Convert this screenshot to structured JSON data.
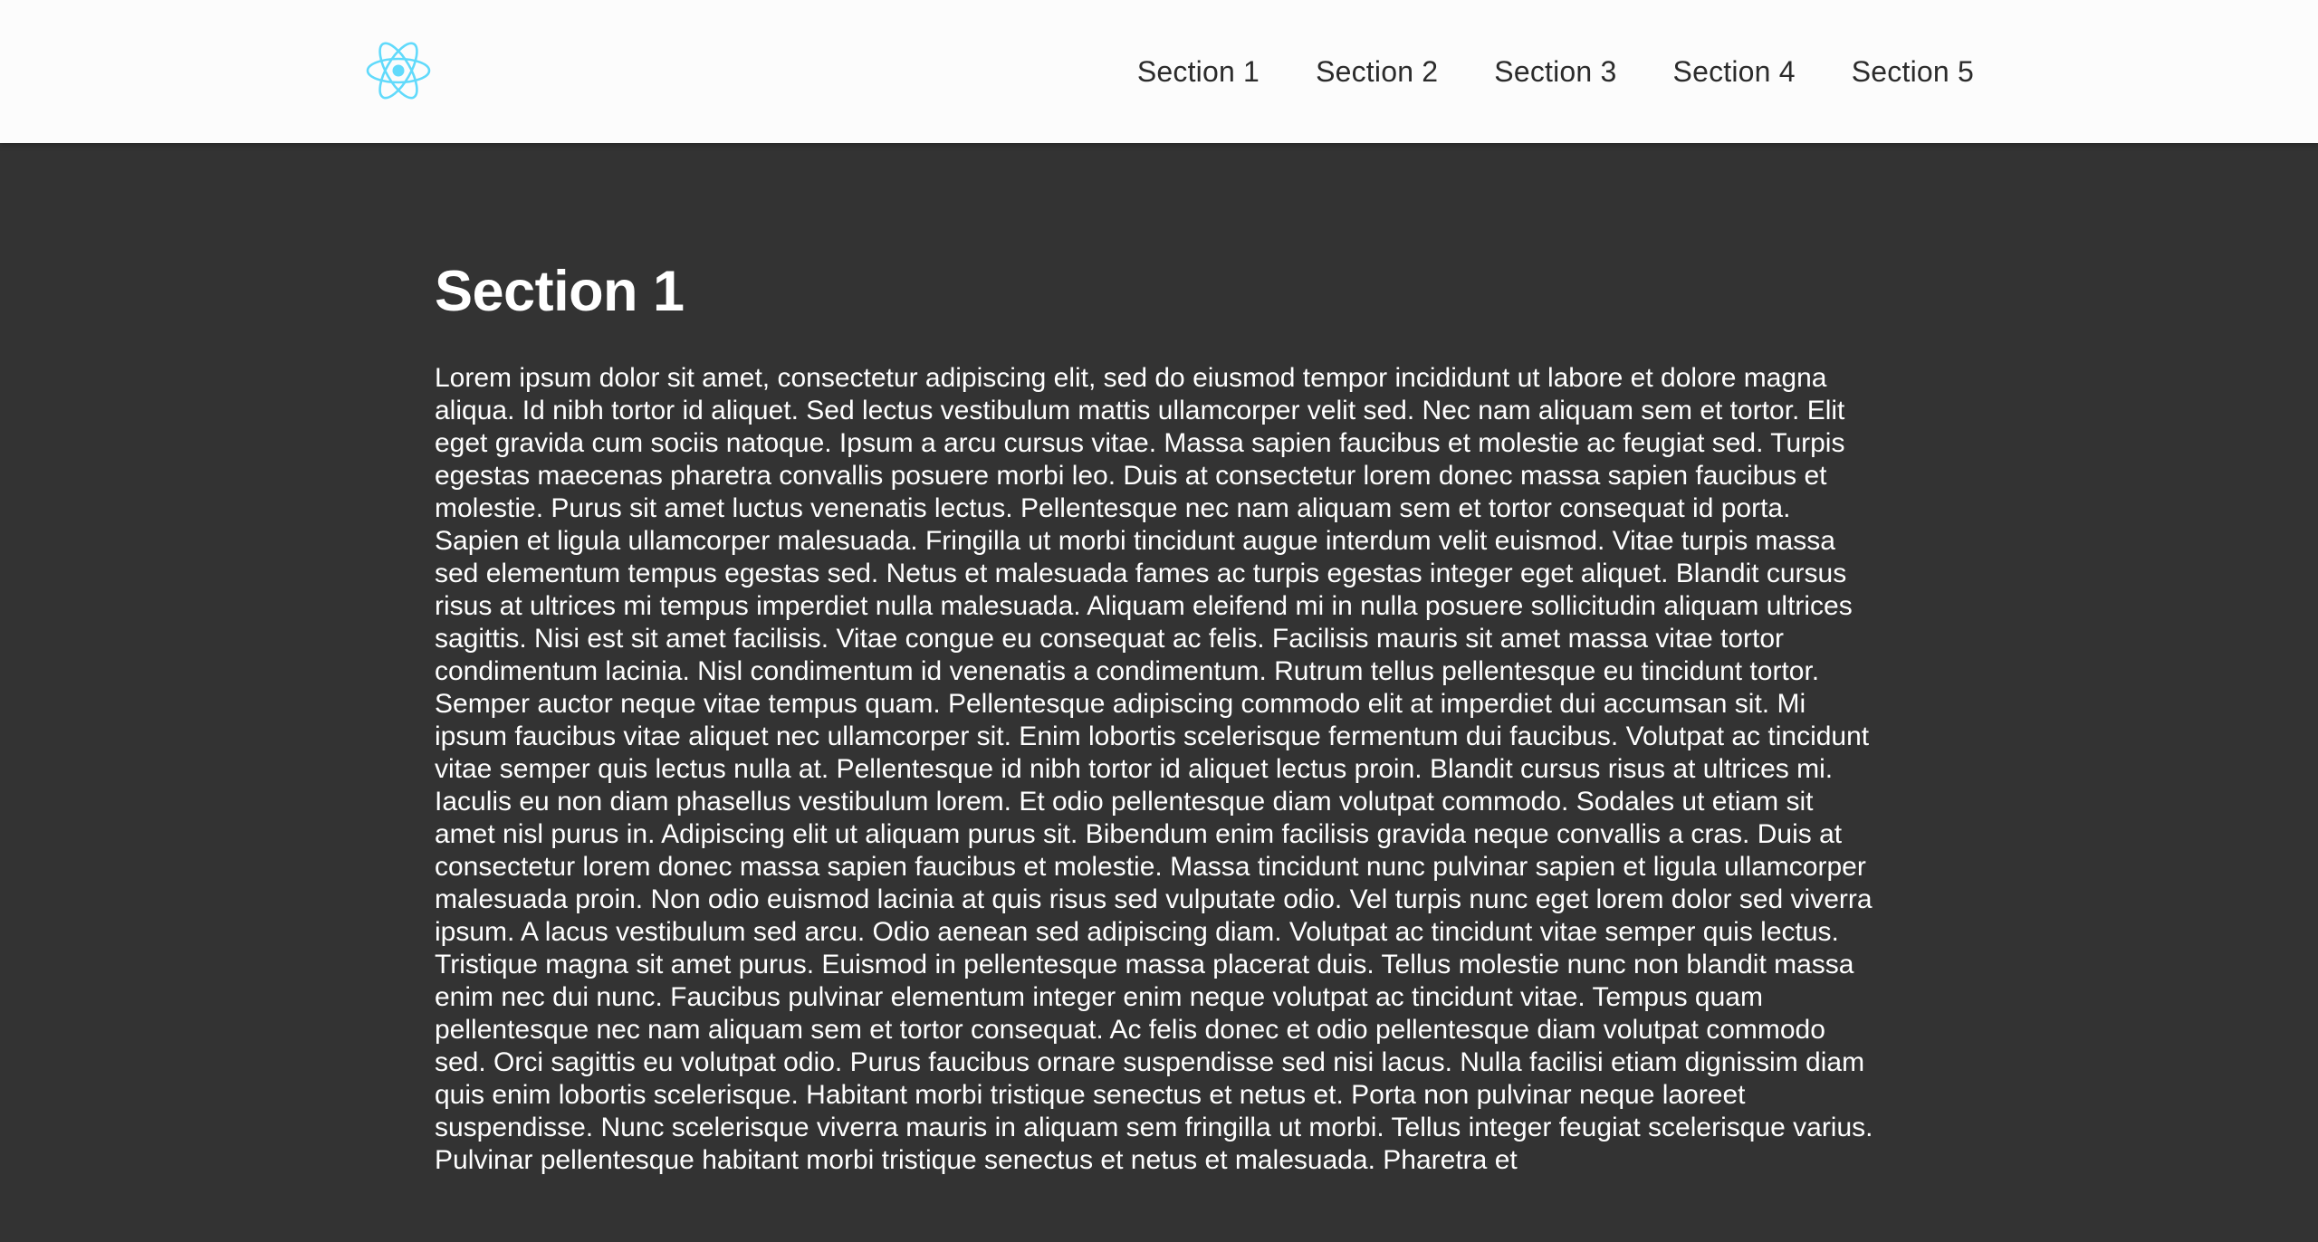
{
  "navbar": {
    "logo_icon": "react-atom-icon",
    "logo_color": "#61dafb",
    "background": "#fcfcfc",
    "links": [
      {
        "label": "Section 1"
      },
      {
        "label": "Section 2"
      },
      {
        "label": "Section 3"
      },
      {
        "label": "Section 4"
      },
      {
        "label": "Section 5"
      }
    ]
  },
  "main": {
    "background": "#333333",
    "section_title": "Section 1",
    "section_body": "Lorem ipsum dolor sit amet, consectetur adipiscing elit, sed do eiusmod tempor incididunt ut labore et dolore magna aliqua. Id nibh tortor id aliquet. Sed lectus vestibulum mattis ullamcorper velit sed. Nec nam aliquam sem et tortor. Elit eget gravida cum sociis natoque. Ipsum a arcu cursus vitae. Massa sapien faucibus et molestie ac feugiat sed. Turpis egestas maecenas pharetra convallis posuere morbi leo. Duis at consectetur lorem donec massa sapien faucibus et molestie. Purus sit amet luctus venenatis lectus. Pellentesque nec nam aliquam sem et tortor consequat id porta. Sapien et ligula ullamcorper malesuada. Fringilla ut morbi tincidunt augue interdum velit euismod. Vitae turpis massa sed elementum tempus egestas sed. Netus et malesuada fames ac turpis egestas integer eget aliquet. Blandit cursus risus at ultrices mi tempus imperdiet nulla malesuada. Aliquam eleifend mi in nulla posuere sollicitudin aliquam ultrices sagittis. Nisi est sit amet facilisis. Vitae congue eu consequat ac felis. Facilisis mauris sit amet massa vitae tortor condimentum lacinia. Nisl condimentum id venenatis a condimentum. Rutrum tellus pellentesque eu tincidunt tortor. Semper auctor neque vitae tempus quam. Pellentesque adipiscing commodo elit at imperdiet dui accumsan sit. Mi ipsum faucibus vitae aliquet nec ullamcorper sit. Enim lobortis scelerisque fermentum dui faucibus. Volutpat ac tincidunt vitae semper quis lectus nulla at. Pellentesque id nibh tortor id aliquet lectus proin. Blandit cursus risus at ultrices mi. Iaculis eu non diam phasellus vestibulum lorem. Et odio pellentesque diam volutpat commodo. Sodales ut etiam sit amet nisl purus in. Adipiscing elit ut aliquam purus sit. Bibendum enim facilisis gravida neque convallis a cras. Duis at consectetur lorem donec massa sapien faucibus et molestie. Massa tincidunt nunc pulvinar sapien et ligula ullamcorper malesuada proin. Non odio euismod lacinia at quis risus sed vulputate odio. Vel turpis nunc eget lorem dolor sed viverra ipsum. A lacus vestibulum sed arcu. Odio aenean sed adipiscing diam. Volutpat ac tincidunt vitae semper quis lectus. Tristique magna sit amet purus. Euismod in pellentesque massa placerat duis. Tellus molestie nunc non blandit massa enim nec dui nunc. Faucibus pulvinar elementum integer enim neque volutpat ac tincidunt vitae. Tempus quam pellentesque nec nam aliquam sem et tortor consequat. Ac felis donec et odio pellentesque diam volutpat commodo sed. Orci sagittis eu volutpat odio. Purus faucibus ornare suspendisse sed nisi lacus. Nulla facilisi etiam dignissim diam quis enim lobortis scelerisque. Habitant morbi tristique senectus et netus et. Porta non pulvinar neque laoreet suspendisse. Nunc scelerisque viverra mauris in aliquam sem fringilla ut morbi. Tellus integer feugiat scelerisque varius. Pulvinar pellentesque habitant morbi tristique senectus et netus et malesuada. Pharetra et"
  }
}
